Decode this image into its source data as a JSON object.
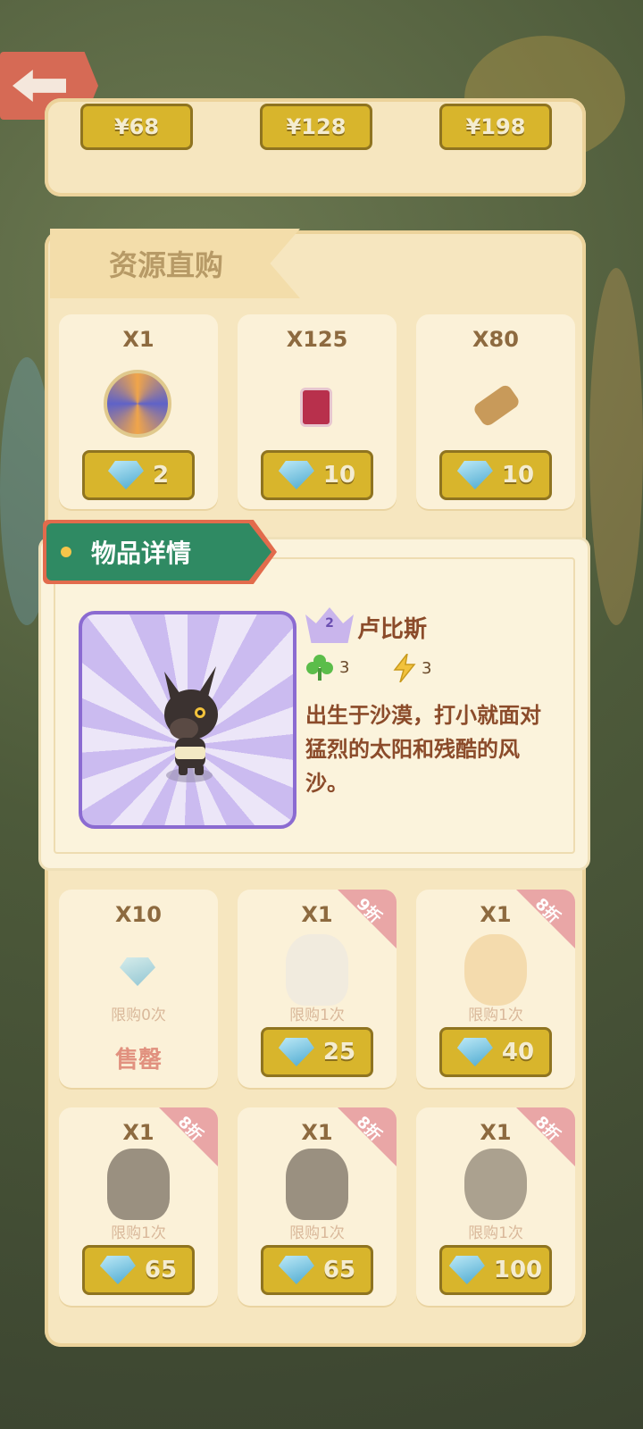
{
  "back_button": {
    "icon": "back-arrow-icon"
  },
  "top_row": {
    "prices": [
      "¥68",
      "¥128",
      "¥198"
    ]
  },
  "resource_section": {
    "title": "资源直购",
    "row1": [
      {
        "qty": "X1",
        "item_icon": "swirl-orb-icon",
        "price": "2"
      },
      {
        "qty": "X125",
        "item_icon": "jam-jar-icon",
        "price": "10"
      },
      {
        "qty": "X80",
        "item_icon": "wood-log-icon",
        "price": "10"
      }
    ],
    "row3": [
      {
        "qty": "X10",
        "item_icon": "gem-icon",
        "limit": "限购0次",
        "status": "售罄",
        "discount": ""
      },
      {
        "qty": "X1",
        "item_icon": "white-tiger-character-icon",
        "limit": "限购1次",
        "price": "25",
        "discount": "9折"
      },
      {
        "qty": "X1",
        "item_icon": "blonde-girl-character-icon",
        "limit": "限购1次",
        "price": "40",
        "discount": "8折"
      }
    ],
    "row4": [
      {
        "qty": "X1",
        "item_icon": "anubis-character-icon",
        "limit": "限购1次",
        "price": "65",
        "discount": "8折"
      },
      {
        "qty": "X1",
        "item_icon": "anubis-character-icon",
        "limit": "限购1次",
        "price": "65",
        "discount": "8折"
      },
      {
        "qty": "X1",
        "item_icon": "crow-character-icon",
        "limit": "限购1次",
        "price": "100",
        "discount": "8折"
      }
    ]
  },
  "detail_popup": {
    "tab_title": "物品详情",
    "level": "2",
    "name": "卢比斯",
    "luck": "3",
    "energy": "3",
    "description": "出生于沙漠，打小就面对猛烈的太阳和残酷的风沙。"
  },
  "colors": {
    "panel": "#f6e6bf",
    "button_gold": "#d8b52c",
    "accent_green": "#2f8a63",
    "accent_orange": "#e26b4c",
    "text_brown": "#8b4b2a",
    "portrait_border": "#8b6bd1"
  }
}
